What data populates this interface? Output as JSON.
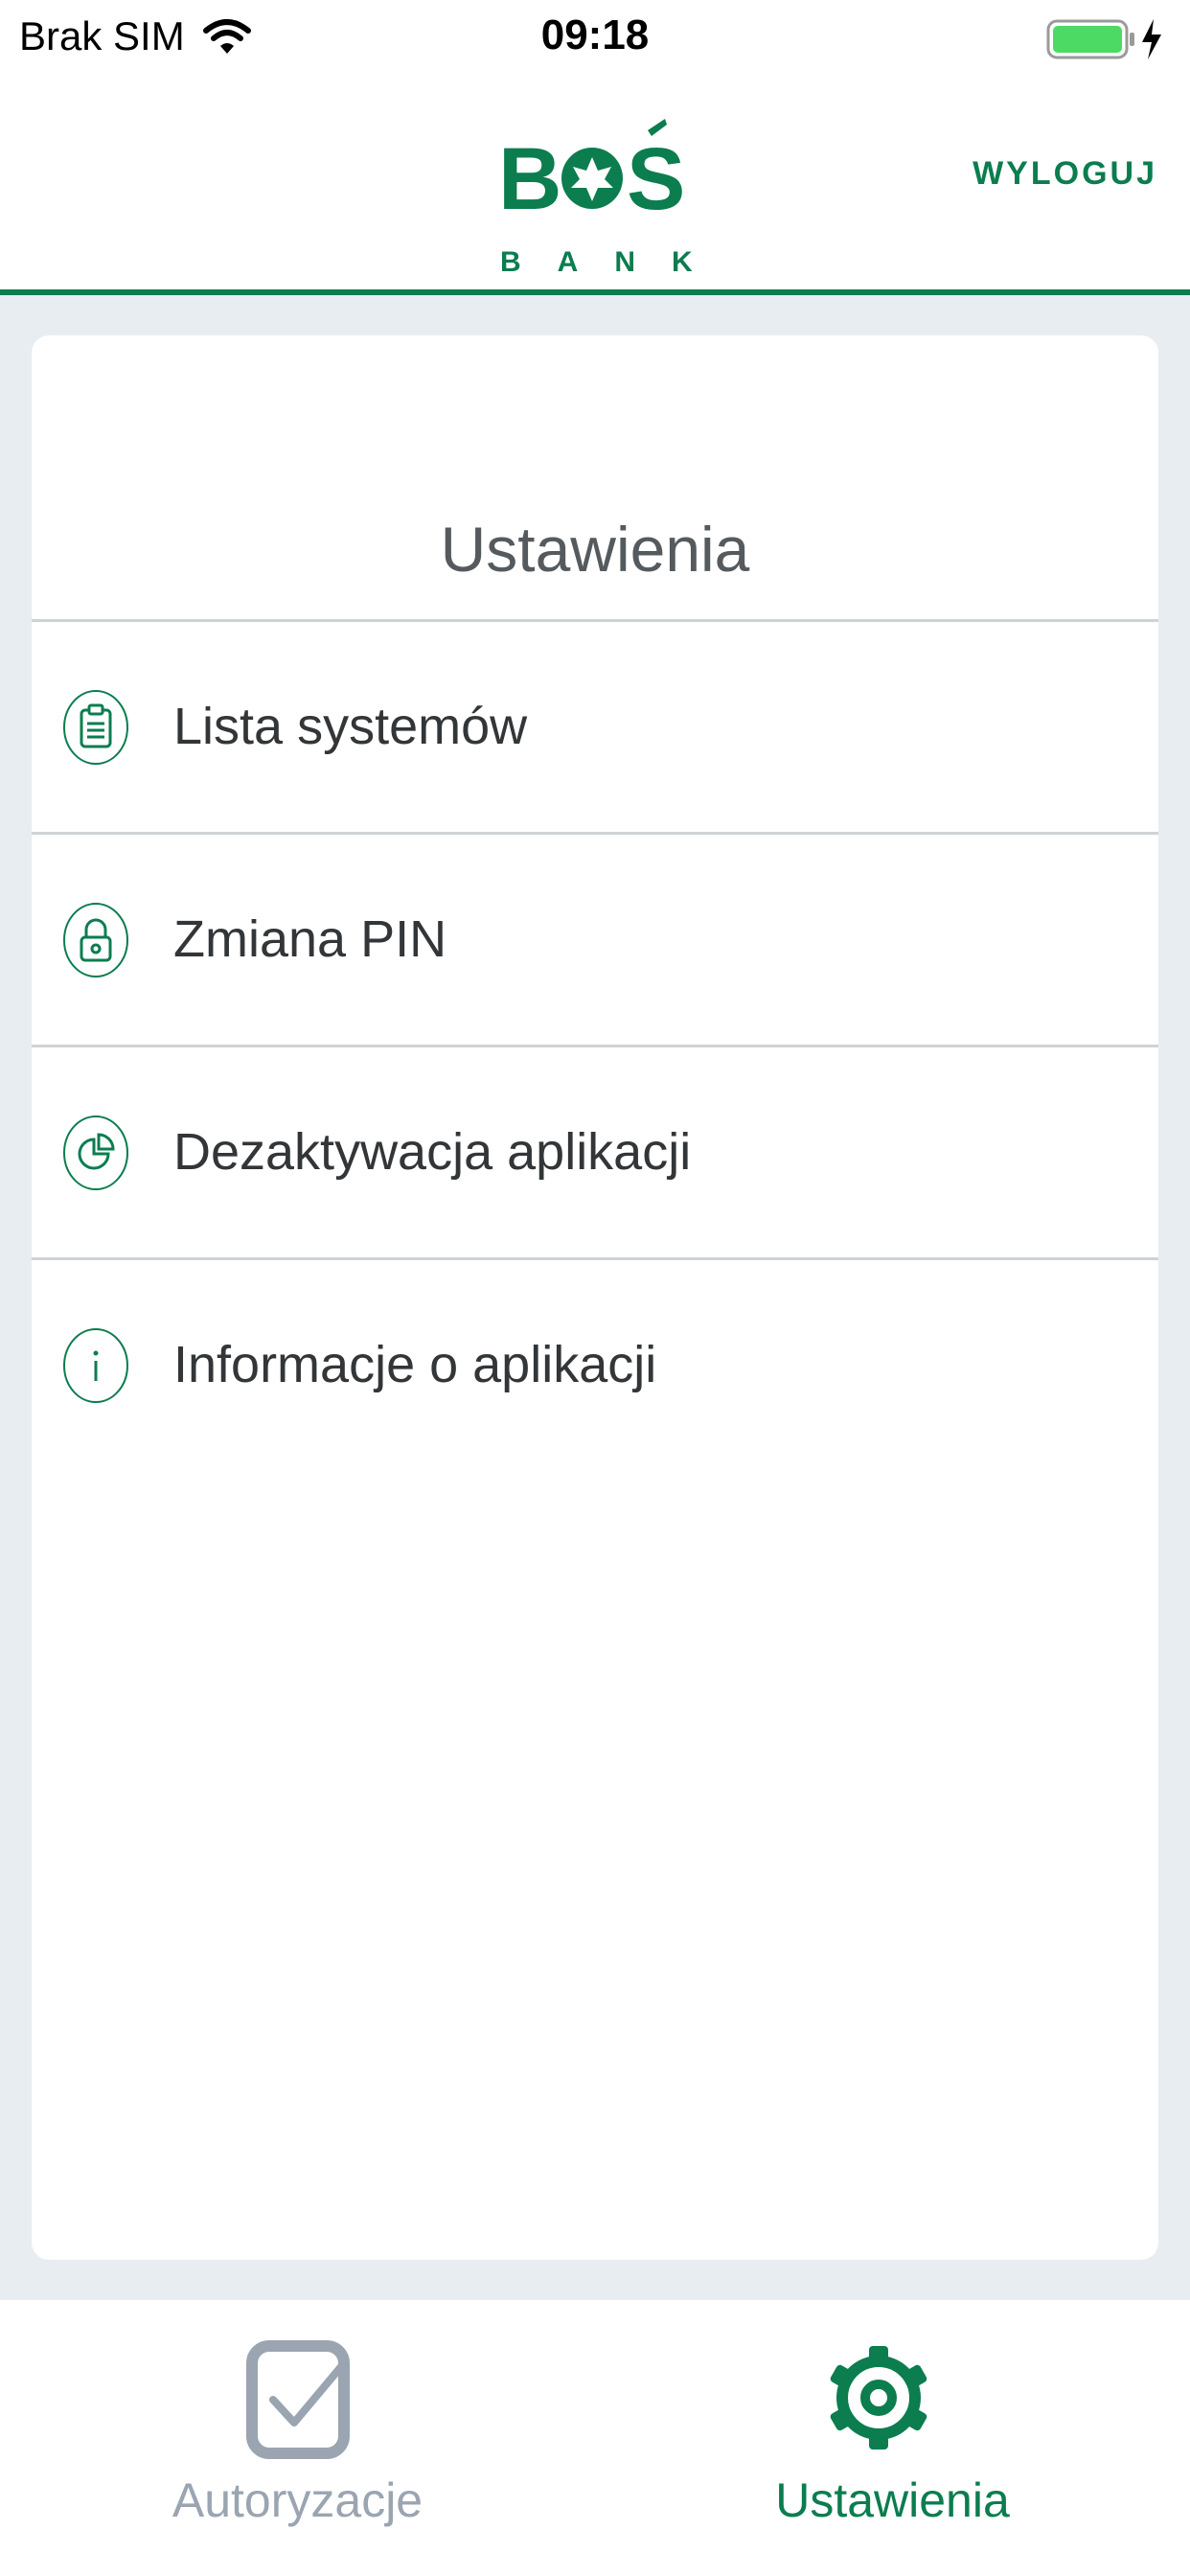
{
  "status_bar": {
    "carrier": "Brak SIM",
    "time": "09:18",
    "battery_color": "#4cd964"
  },
  "header": {
    "logo_text": "BOŚ",
    "logo_subtext": "B A N K",
    "logout_label": "WYLOGUJ",
    "accent_color": "#0b7d4f"
  },
  "main": {
    "title": "Ustawienia",
    "menu": [
      {
        "label": "Lista systemów",
        "icon": "clipboard-icon"
      },
      {
        "label": "Zmiana PIN",
        "icon": "lock-icon"
      },
      {
        "label": "Dezaktywacja aplikacji",
        "icon": "pie-chart-icon"
      },
      {
        "label": "Informacje o aplikacji",
        "icon": "info-icon"
      }
    ]
  },
  "tabbar": {
    "tabs": [
      {
        "label": "Autoryzacje",
        "icon": "checkbox-icon",
        "active": false,
        "color": "#9aa5b1"
      },
      {
        "label": "Ustawienia",
        "icon": "gear-icon",
        "active": true,
        "color": "#0b7d4f"
      }
    ]
  }
}
